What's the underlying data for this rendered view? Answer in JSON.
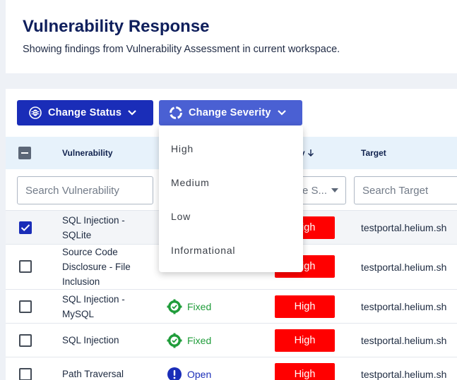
{
  "header": {
    "title": "Vulnerability Response",
    "subtitle": "Showing findings from Vulnerability Assessment in current workspace."
  },
  "toolbar": {
    "change_status_label": "Change Status",
    "change_severity_label": "Change Severity"
  },
  "severity_menu": {
    "options": [
      "High",
      "Medium",
      "Low",
      "Informational"
    ]
  },
  "table": {
    "columns": {
      "vulnerability": "Vulnerability",
      "severity": "rity",
      "target": "Target"
    },
    "filters": {
      "vulnerability_placeholder": "Search Vulnerability",
      "severity_placeholder": "e S...",
      "target_placeholder": "Search Target"
    },
    "rows": [
      {
        "vulnerability": "SQL Injection - SQLite",
        "status": "",
        "status_icon": "",
        "severity": "High",
        "target": "testportal.helium.sh",
        "checked": true
      },
      {
        "vulnerability": "Source Code Disclosure - File Inclusion",
        "status": "",
        "status_icon": "",
        "severity": "High",
        "target": "testportal.helium.sh",
        "checked": false
      },
      {
        "vulnerability": "SQL Injection - MySQL",
        "status": "Fixed",
        "status_icon": "fixed-icon",
        "severity": "High",
        "target": "testportal.helium.sh",
        "checked": false
      },
      {
        "vulnerability": "SQL Injection",
        "status": "Fixed",
        "status_icon": "fixed-icon",
        "severity": "High",
        "target": "testportal.helium.sh",
        "checked": false
      },
      {
        "vulnerability": "Path Traversal",
        "status": "Open",
        "status_icon": "open-icon",
        "severity": "High",
        "target": "testportal.helium.sh",
        "checked": false
      }
    ]
  },
  "colors": {
    "primary": "#1a2db8",
    "secondary": "#4a60d3",
    "severity_high": "#ff0000",
    "status_fixed": "#1f9c3a",
    "status_open": "#1a2db8"
  }
}
